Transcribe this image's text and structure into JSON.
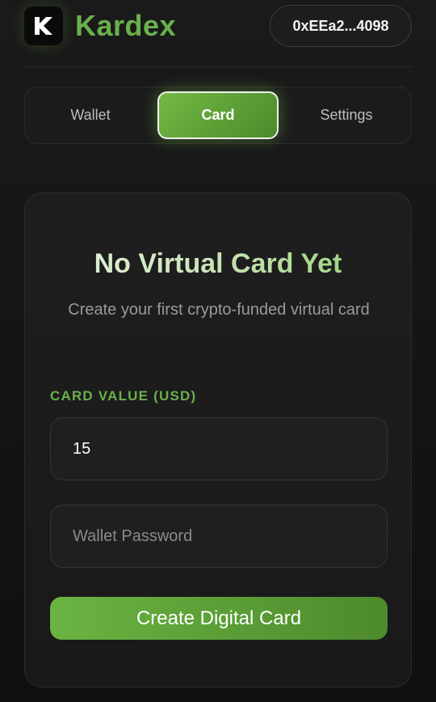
{
  "header": {
    "brand_name": "Kardex",
    "logo_letter": "K",
    "wallet_address": "0xEEa2...4098"
  },
  "tabs": [
    {
      "label": "Wallet",
      "active": false
    },
    {
      "label": "Card",
      "active": true
    },
    {
      "label": "Settings",
      "active": false
    }
  ],
  "empty_state": {
    "title": "No Virtual Card Yet",
    "subtitle": "Create your first crypto-funded virtual card"
  },
  "form": {
    "card_value_label": "CARD VALUE (USD)",
    "card_value": "15",
    "password_placeholder": "Wallet Password",
    "submit_label": "Create Digital Card"
  },
  "colors": {
    "accent": "#6ab04c",
    "background": "#141414",
    "panel": "#1e1e1e"
  }
}
